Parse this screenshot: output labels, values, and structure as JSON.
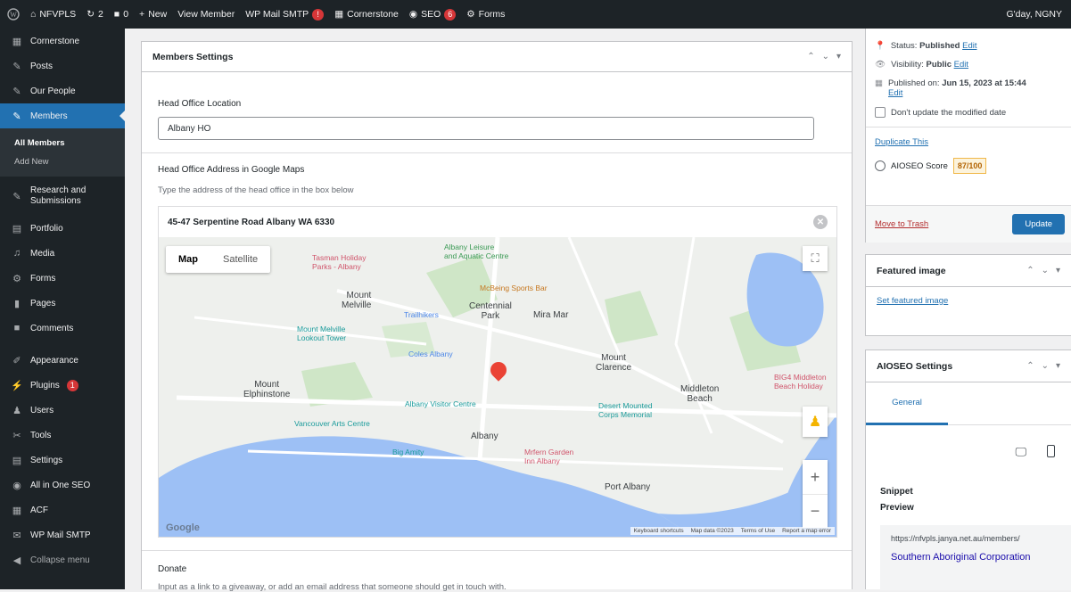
{
  "adminbar": {
    "site_name": "NFVPLS",
    "updates_count": "2",
    "comments_count": "0",
    "new_label": "New",
    "view_label": "View Member",
    "smtp_label": "WP Mail SMTP",
    "smtp_badge": "!",
    "cornerstone_label": "Cornerstone",
    "seo_label": "SEO",
    "seo_badge": "6",
    "forms_label": "Forms",
    "greeting": "G'day, NGNY"
  },
  "sidebar": {
    "items": [
      {
        "label": "Cornerstone",
        "icon": "grid-icon"
      },
      {
        "label": "Posts",
        "icon": "pin-icon"
      },
      {
        "label": "Our People",
        "icon": "pin-icon"
      },
      {
        "label": "Members",
        "icon": "pin-icon"
      },
      {
        "label": "Research and Submissions",
        "icon": "pin-icon"
      },
      {
        "label": "Portfolio",
        "icon": "portfolio-icon"
      },
      {
        "label": "Media",
        "icon": "media-icon"
      },
      {
        "label": "Forms",
        "icon": "forms-icon"
      },
      {
        "label": "Pages",
        "icon": "pages-icon"
      },
      {
        "label": "Comments",
        "icon": "comments-icon"
      },
      {
        "label": "Appearance",
        "icon": "brush-icon"
      },
      {
        "label": "Plugins",
        "icon": "plugin-icon"
      },
      {
        "label": "Users",
        "icon": "users-icon"
      },
      {
        "label": "Tools",
        "icon": "tools-icon"
      },
      {
        "label": "Settings",
        "icon": "settings-icon"
      },
      {
        "label": "All in One SEO",
        "icon": "seo-icon"
      },
      {
        "label": "ACF",
        "icon": "acf-icon"
      },
      {
        "label": "WP Mail SMTP",
        "icon": "mail-icon"
      },
      {
        "label": "Collapse menu",
        "icon": "collapse-icon"
      }
    ],
    "submenu": [
      "All Members",
      "Add New"
    ],
    "plugins_badge": "1"
  },
  "members_settings": {
    "title": "Members Settings",
    "office_location_label": "Head Office Location",
    "office_location_value": "Albany HO",
    "address_label": "Head Office Address in Google Maps",
    "address_hint": "Type the address of the head office in the box below",
    "address_value": "45-47 Serpentine Road Albany WA 6330"
  },
  "map": {
    "map_tab": "Map",
    "satellite_tab": "Satellite",
    "labels": {
      "mount_melville": "Mount\nMelville",
      "centennial": "Centennial\nPark",
      "mira_mar": "Mira Mar",
      "mount_clarence": "Mount\nClarence",
      "mount_elphinstone": "Mount\nElphinstone",
      "middleton": "Middleton\nBeach",
      "albany": "Albany",
      "port_albany": "Port Albany"
    },
    "pois": {
      "tasman": "Tasman Holiday\nParks - Albany",
      "leisure": "Albany Leisure\nand Aquatic Centre",
      "mcbeing": "McBeing Sports Bar",
      "trailhikers": "Trailhikers",
      "lookout": "Mount Melville\nLookout Tower",
      "coles": "Coles Albany",
      "visitor": "Albany Visitor Centre",
      "desert": "Desert Mounted\nCorps Memorial",
      "vancouver": "Vancouver Arts Centre",
      "big4": "BIG4 Middleton\nBeach Holiday",
      "bigamity": "Big Amity",
      "garden": "Mrfern Garden\nInn Albany"
    },
    "footer": {
      "shortcuts": "Keyboard shortcuts",
      "data": "Map data ©2023",
      "terms": "Terms of Use",
      "report": "Report a map error"
    },
    "zoom_in": "+",
    "zoom_out": "−",
    "google": "Google"
  },
  "donate": {
    "label": "Donate",
    "hint": "Input as a link to a giveaway, or add an email address that someone should get in touch with."
  },
  "publish": {
    "status_label": "Status:",
    "status_value": "Published",
    "visibility_label": "Visibility:",
    "visibility_value": "Public",
    "published_on_label": "Published on:",
    "published_on_value": "Jun 15, 2023 at 15:44",
    "edit": "Edit",
    "dont_update_label": "Don't update the modified date",
    "duplicate": "Duplicate This",
    "aioseo_label": "AIOSEO Score",
    "aioseo_score": "87/100",
    "trash": "Move to Trash",
    "update": "Update"
  },
  "featured_image": {
    "title": "Featured image",
    "set_link": "Set featured image"
  },
  "aioseo_settings": {
    "title": "AIOSEO Settings",
    "tab_general": "General",
    "snippet_label": "Snippet",
    "preview_label": "Preview",
    "url": "https://nfvpls.janya.net.au/members/",
    "site_title": "Southern Aboriginal Corporation"
  },
  "colors": {
    "accent": "#2271b1",
    "admin_dark": "#1d2327",
    "badge_red": "#d63638",
    "score_orange": "#f0b849"
  }
}
